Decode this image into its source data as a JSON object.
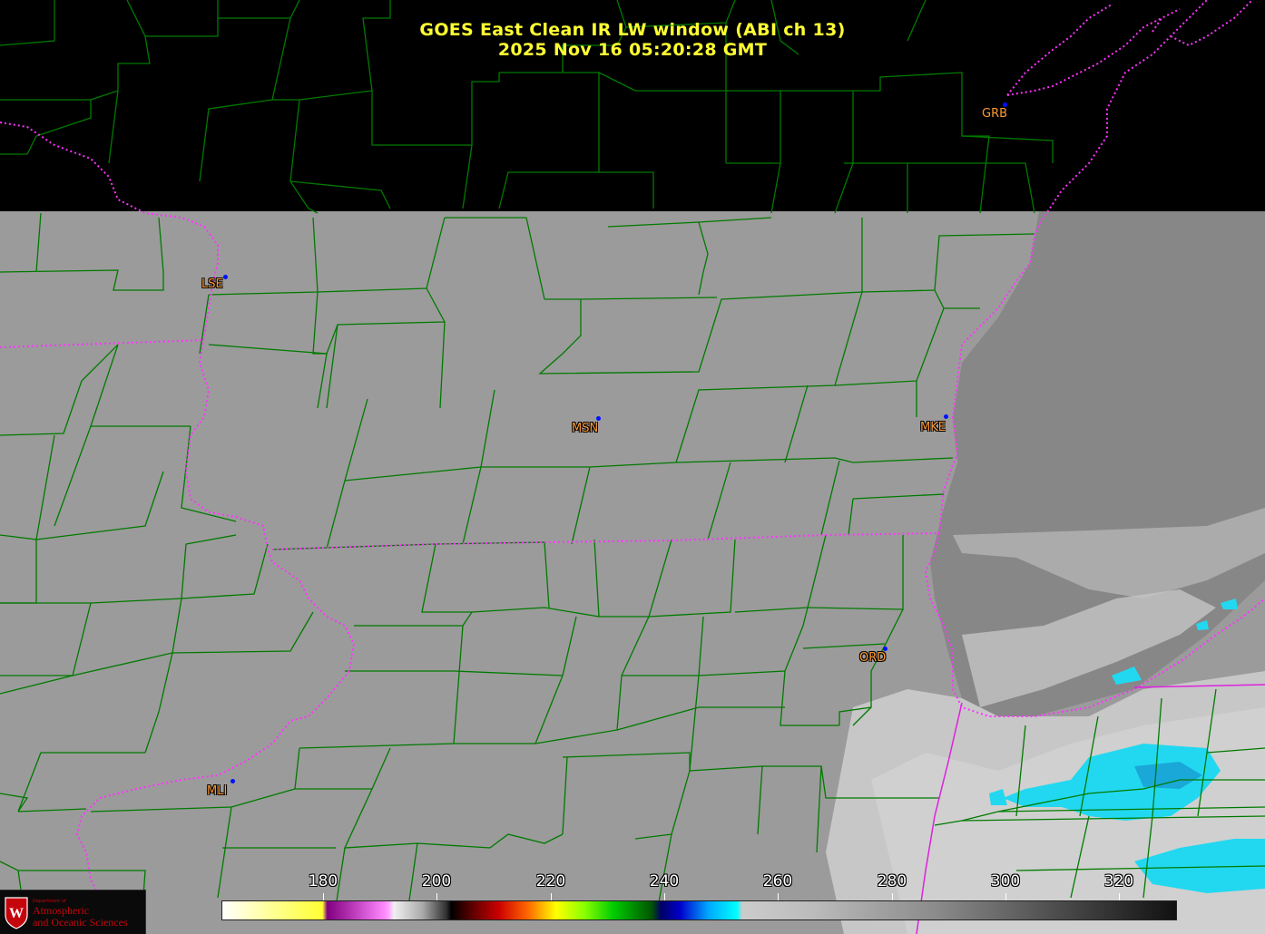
{
  "title": {
    "line1": "GOES East Clean IR LW window (ABI ch 13)",
    "line2": "2025 Nov 16  05:20:28 GMT"
  },
  "stations": [
    {
      "id": "GRB"
    },
    {
      "id": "LSE"
    },
    {
      "id": "MSN"
    },
    {
      "id": "MKE"
    },
    {
      "id": "ORD"
    },
    {
      "id": "MLI"
    }
  ],
  "colorbar": {
    "ticks": [
      "180",
      "200",
      "220",
      "240",
      "260",
      "280",
      "300",
      "320"
    ]
  },
  "logo": {
    "dept": "Department of",
    "line1": "Atmospheric",
    "line2": "and Oceanic Sciences"
  },
  "colors": {
    "title": "#ffff33",
    "station_label": "#ff9933",
    "station_dot": "#0010ff",
    "county_lines": "#007a00",
    "state_lines": "#ff33ff",
    "no_data": "#000000",
    "background_ir": "#9a9a9a",
    "cold_cloud": "#22d8f0"
  }
}
